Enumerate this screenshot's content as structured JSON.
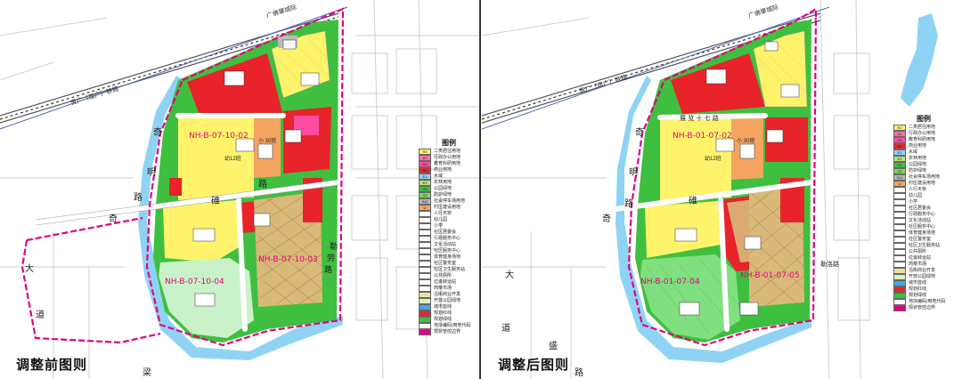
{
  "left": {
    "title": "调整前图则",
    "plan_ids": [
      "NH-B-07-10-02",
      "NH-B-07-10-03",
      "NH-B-07-10-04"
    ],
    "roads": [
      "奇",
      "明",
      "路",
      "大",
      "道",
      "奇",
      "碓",
      "路",
      "勒",
      "劳",
      "路",
      "梁",
      "广佛肇城际",
      "贵广（南广）铁路"
    ],
    "labels": [
      "小 30班",
      "幼12班"
    ]
  },
  "right": {
    "title": "调整后图则",
    "plan_ids": [
      "NH-B-01-07-02",
      "NH-B-01-07-04",
      "NH-B-01-07-05"
    ],
    "roads": [
      "奇",
      "明",
      "路",
      "大",
      "道",
      "奇",
      "盛",
      "路",
      "碓",
      "路",
      "勒洛路",
      "广佛肇城际",
      "贵广（南广）铁路",
      "展 览 十 七 路"
    ],
    "labels": [
      "小 30班",
      "幼12班"
    ]
  },
  "legend": {
    "title": "图例",
    "items": [
      {
        "code": "R2",
        "label": "二类居住用地",
        "color": "#fff36b"
      },
      {
        "code": "A1",
        "label": "行政办公用地",
        "color": "#ff6fa8"
      },
      {
        "code": "A3",
        "label": "教育科研用地",
        "color": "#ff4da6"
      },
      {
        "code": "B1",
        "label": "商业用地",
        "color": "#e8232a"
      },
      {
        "code": "E1",
        "label": "水域",
        "color": "#8fd3f4"
      },
      {
        "code": "E2",
        "label": "农林用地",
        "color": "#b6e27a"
      },
      {
        "code": "G1",
        "label": "公园绿地",
        "color": "#3fbf3f"
      },
      {
        "code": "G2",
        "label": "防护绿地",
        "color": "#7ed957"
      },
      {
        "code": "S42",
        "label": "社会停车场用地",
        "color": "#bbbbbb"
      },
      {
        "code": "U",
        "label": "村庄建设用地",
        "color": "#f4a460"
      },
      {
        "code": "",
        "label": "人行天桥",
        "color": "#ffffff"
      },
      {
        "code": "",
        "label": "幼儿园",
        "color": "#ffffff"
      },
      {
        "code": "",
        "label": "小学",
        "color": "#ffffff"
      },
      {
        "code": "",
        "label": "社区居委会",
        "color": "#ffffff"
      },
      {
        "code": "",
        "label": "行政服务中心",
        "color": "#ffffff"
      },
      {
        "code": "",
        "label": "文化活动站",
        "color": "#ffffff"
      },
      {
        "code": "",
        "label": "社区服务中心",
        "color": "#ffffff"
      },
      {
        "code": "",
        "label": "体育健身场地",
        "color": "#ffffff"
      },
      {
        "code": "",
        "label": "社区警务室",
        "color": "#ffffff"
      },
      {
        "code": "",
        "label": "社区卫生服务站",
        "color": "#ffffff"
      },
      {
        "code": "",
        "label": "公共厕所",
        "color": "#ffffff"
      },
      {
        "code": "",
        "label": "垃圾转运站",
        "color": "#ffffff"
      },
      {
        "code": "",
        "label": "肉菜市场",
        "color": "#ffffff"
      },
      {
        "code": "",
        "label": "沿街商业开发",
        "color": "#f0e0a0"
      },
      {
        "code": "",
        "label": "开放公园绿地",
        "color": "#d9f2c2"
      },
      {
        "code": "",
        "label": "城市蓝线",
        "color": "#4aa3df"
      },
      {
        "code": "",
        "label": "规划红线",
        "color": "#e8232a"
      },
      {
        "code": "",
        "label": "规划绿线",
        "color": "#3fbf3f"
      },
      {
        "code": "",
        "label": "地块编码/用地代码",
        "color": "#ffffff"
      },
      {
        "code": "",
        "label": "现状管控边界",
        "color": "#e3007e"
      }
    ]
  },
  "colors": {
    "magenta": "#e3007e",
    "water": "#8fd3f4",
    "green": "#3fbf3f",
    "lightgreen": "#c9f2c9",
    "yellow": "#fff36b",
    "red": "#e8232a",
    "orange": "#f4a460",
    "pink": "#ff4da6"
  }
}
